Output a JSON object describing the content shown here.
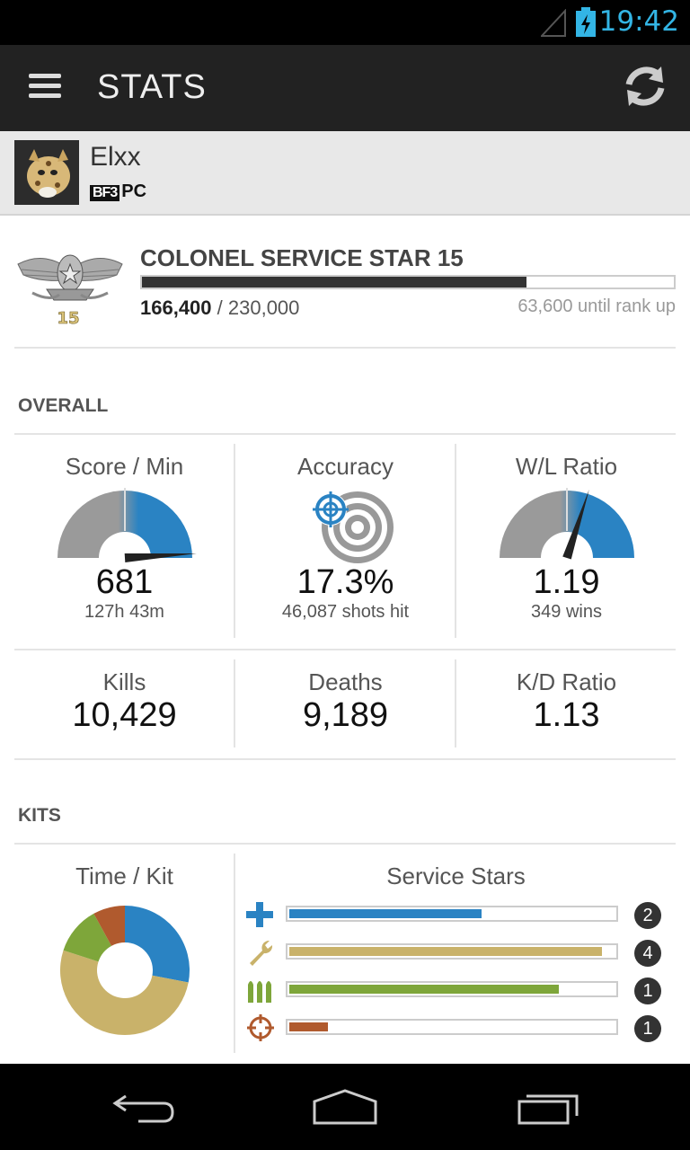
{
  "status_bar": {
    "time": "19:42",
    "signal_icon": "signal-icon",
    "battery_icon": "battery-charging-icon",
    "accent": "#33b5e5"
  },
  "action_bar": {
    "title": "STATS",
    "menu_icon": "hamburger-icon",
    "refresh_icon": "refresh-icon"
  },
  "profile": {
    "name": "Elxx",
    "game_logo": "BF3",
    "platform": "PC",
    "avatar_icon": "ocelot-avatar"
  },
  "rank": {
    "title": "COLONEL SERVICE STAR 15",
    "insignia_number": "15",
    "current_xp": "166,400",
    "separator": " / ",
    "target_xp": "230,000",
    "progress_fraction": 0.7235,
    "until_rank_up": "63,600 until rank up"
  },
  "overall": {
    "header": "OVERALL",
    "score_min": {
      "label": "Score / Min",
      "value": "681",
      "sub": "127h 43m",
      "gauge_fraction": 0.98
    },
    "accuracy": {
      "label": "Accuracy",
      "value": "17.3%",
      "sub": "46,087 shots hit",
      "icon": "target-icon"
    },
    "wl_ratio": {
      "label": "W/L Ratio",
      "value": "1.19",
      "sub": "349 wins",
      "gauge_fraction": 0.6
    },
    "kills": {
      "label": "Kills",
      "value": "10,429"
    },
    "deaths": {
      "label": "Deaths",
      "value": "9,189"
    },
    "kd_ratio": {
      "label": "K/D Ratio",
      "value": "1.13"
    }
  },
  "kits": {
    "header": "KITS",
    "time_label": "Time / Kit",
    "stars_label": "Service Stars",
    "time_share": [
      {
        "kit": "assault",
        "fraction": 0.28,
        "color": "#2a83c3"
      },
      {
        "kit": "engineer",
        "fraction": 0.52,
        "color": "#c9b26a"
      },
      {
        "kit": "support",
        "fraction": 0.12,
        "color": "#7ea63a"
      },
      {
        "kit": "recon",
        "fraction": 0.08,
        "color": "#b05a2e"
      }
    ],
    "stars": [
      {
        "kit": "assault",
        "icon": "medic-cross-icon",
        "count": "2",
        "progress": 0.59,
        "color": "#2a83c3"
      },
      {
        "kit": "engineer",
        "icon": "wrench-icon",
        "count": "4",
        "progress": 0.96,
        "color": "#c9b26a"
      },
      {
        "kit": "support",
        "icon": "ammo-icon",
        "count": "1",
        "progress": 0.83,
        "color": "#7ea63a"
      },
      {
        "kit": "recon",
        "icon": "crosshair-icon",
        "count": "1",
        "progress": 0.12,
        "color": "#b05a2e"
      }
    ]
  },
  "nav_bar": {
    "back_icon": "back-icon",
    "home_icon": "home-icon",
    "recents_icon": "recents-icon"
  }
}
